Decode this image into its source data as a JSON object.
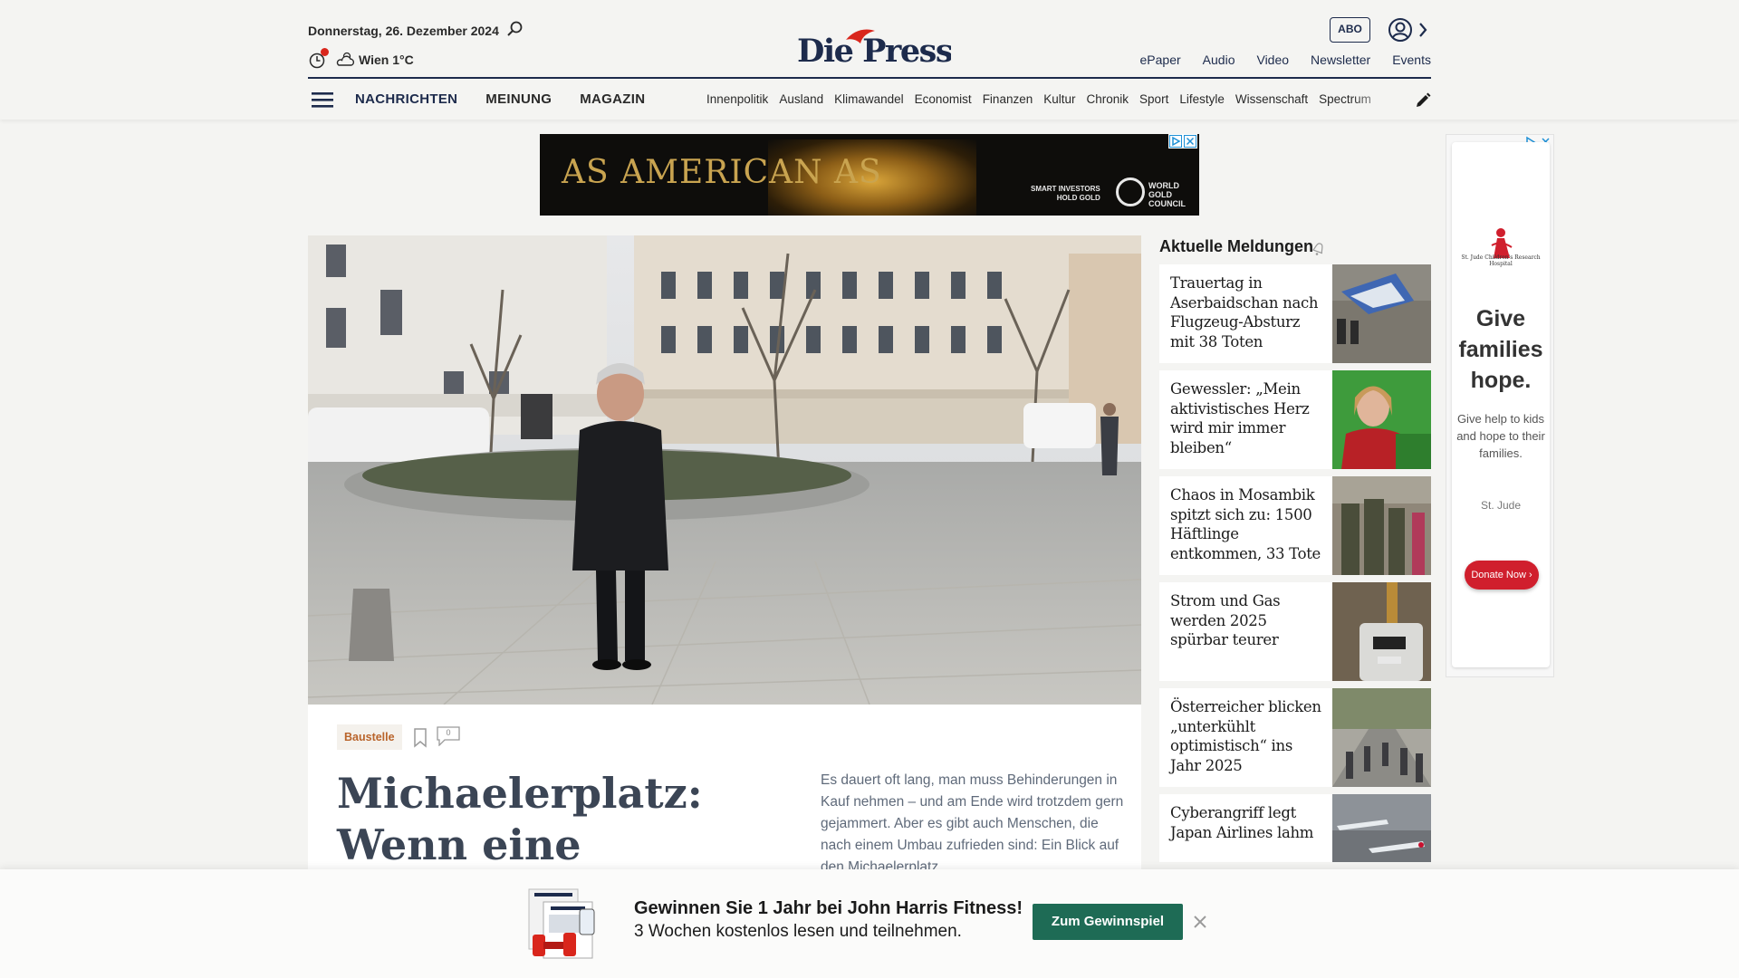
{
  "header": {
    "date": "Donnerstag, 26. Dezember 2024",
    "weather": "Wien 1°C",
    "logo": "Die Presse",
    "abo_label": "ABO",
    "top_links": [
      "ePaper",
      "Audio",
      "Video",
      "Newsletter",
      "Events"
    ],
    "main_nav": [
      "NACHRICHTEN",
      "MEINUNG",
      "MAGAZIN"
    ],
    "sub_nav": [
      "Innenpolitik",
      "Ausland",
      "Klimawandel",
      "Economist",
      "Finanzen",
      "Kultur",
      "Chronik",
      "Sport",
      "Lifestyle",
      "Wissenschaft",
      "Spectrum"
    ],
    "accent_color": "#1d2b4c",
    "logo_mark_color": "#d9261c"
  },
  "ad_banner": {
    "headline": "AS AMERICAN AS",
    "tagline_1": "SMART INVESTORS",
    "tagline_2": "HOLD GOLD",
    "brand_1": "WORLD",
    "brand_2": "GOLD",
    "brand_3": "COUNCIL"
  },
  "article": {
    "tag": "Baustelle",
    "comment_count": "0",
    "headline": "Michaelerplatz: Wenn eine Baustelle",
    "lead": "Es dauert oft lang, man muss Behinderungen in Kauf nehmen – und am Ende wird trotzdem gern gejammert. Aber es gibt auch Menschen, die nach einem Umbau zufrieden sind: Ein Blick auf den Michaelerplatz."
  },
  "sidebar": {
    "title": "Aktuelle Meldungen",
    "items": [
      {
        "text": "Trauertag in Aserbaidschan nach Flugzeug-Absturz mit 38 Toten",
        "thumb": "plane-wreck"
      },
      {
        "text": "Gewessler: „Mein aktivistisches Herz wird mir immer bleiben“",
        "thumb": "politician-green"
      },
      {
        "text": "Chaos in Mosambik spitzt sich zu: 1500 Häftlinge entkommen, 33 Tote",
        "thumb": "soldiers"
      },
      {
        "text": "Strom und Gas werden 2025 spürbar teurer",
        "thumb": "gas-meter"
      },
      {
        "text": "Österreicher blicken „unterkühlt optimistisch“ ins Jahr 2025",
        "thumb": "street-crowd"
      },
      {
        "text": "Cyberangriff legt Japan Airlines lahm",
        "thumb": "airplanes"
      }
    ]
  },
  "sky_ad": {
    "logo_text": "St. Jude Children's Research Hospital",
    "headline": "Give families hope.",
    "sub": "Give help to kids and hope to their families.",
    "brand": "St. Jude",
    "button": "Donate Now ›"
  },
  "promo": {
    "title": "Gewinnen Sie 1 Jahr bei John Harris Fitness!",
    "sub": "3 Wochen kostenlos lesen und teilnehmen.",
    "button": "Zum Gewinnspiel"
  }
}
